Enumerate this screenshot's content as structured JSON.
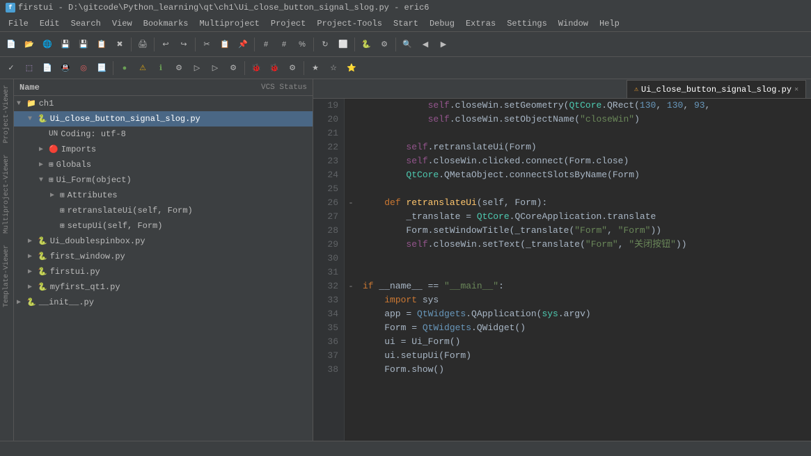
{
  "titleBar": {
    "icon": "f",
    "text": "firstui - D:\\gitcode\\Python_learning\\qt\\ch1\\Ui_close_button_signal_slog.py - eric6"
  },
  "menuBar": {
    "items": [
      "File",
      "Edit",
      "Search",
      "View",
      "Bookmarks",
      "Multiproject",
      "Project",
      "Project-Tools",
      "Start",
      "Debug",
      "Extras",
      "Settings",
      "Window",
      "Help"
    ]
  },
  "tabs": [
    {
      "label": "Ui_close_button_signal_slog.py",
      "active": true,
      "warning": true
    }
  ],
  "projectPanel": {
    "headerLeft": "Name",
    "headerRight": "VCS Status",
    "tree": [
      {
        "indent": 0,
        "arrow": "▼",
        "icon": "📁",
        "label": "ch1",
        "type": "folder"
      },
      {
        "indent": 1,
        "arrow": "▼",
        "icon": "🐍",
        "label": "Ui_close_button_signal_slog.py",
        "type": "file",
        "selected": true
      },
      {
        "indent": 2,
        "arrow": "",
        "icon": "UN",
        "label": "Coding: utf-8",
        "type": "info"
      },
      {
        "indent": 2,
        "arrow": "▶",
        "icon": "🔴",
        "label": "Imports",
        "type": "node"
      },
      {
        "indent": 2,
        "arrow": "▶",
        "icon": "⊞",
        "label": "Globals",
        "type": "node"
      },
      {
        "indent": 2,
        "arrow": "▼",
        "icon": "⊞",
        "label": "Ui_Form(object)",
        "type": "class"
      },
      {
        "indent": 3,
        "arrow": "▶",
        "icon": "⊞",
        "label": "Attributes",
        "type": "node"
      },
      {
        "indent": 3,
        "arrow": "",
        "icon": "⊞",
        "label": "retranslateUi(self, Form)",
        "type": "method"
      },
      {
        "indent": 3,
        "arrow": "",
        "icon": "⊞",
        "label": "setupUi(self, Form)",
        "type": "method"
      },
      {
        "indent": 1,
        "arrow": "▶",
        "icon": "🐍",
        "label": "Ui_doublespinbox.py",
        "type": "file"
      },
      {
        "indent": 1,
        "arrow": "▶",
        "icon": "🐍",
        "label": "first_window.py",
        "type": "file"
      },
      {
        "indent": 1,
        "arrow": "▶",
        "icon": "🐍",
        "label": "firstui.py",
        "type": "file"
      },
      {
        "indent": 1,
        "arrow": "▶",
        "icon": "🐍",
        "label": "myfirst_qt1.py",
        "type": "file"
      },
      {
        "indent": 0,
        "arrow": "▶",
        "icon": "🐍",
        "label": "__init__.py",
        "type": "file"
      }
    ]
  },
  "sideLabels": [
    "Project-Viewer",
    "Multiproject-Viewer",
    "Template-Viewer"
  ],
  "editor": {
    "filename": "Ui_close_button_signal_slog.py",
    "lines": [
      {
        "num": 19,
        "gutter": "",
        "code": [
          {
            "t": "            ",
            "c": "plain"
          },
          {
            "t": "self",
            "c": "self"
          },
          {
            "t": ".closeWin.setGeometry(",
            "c": "plain"
          },
          {
            "t": "QtCore",
            "c": "qt"
          },
          {
            "t": ".QRect(",
            "c": "plain"
          },
          {
            "t": "130",
            "c": "num"
          },
          {
            "t": ", ",
            "c": "plain"
          },
          {
            "t": "130",
            "c": "num"
          },
          {
            "t": ", ",
            "c": "plain"
          },
          {
            "t": "93",
            "c": "num"
          },
          {
            "t": ",",
            "c": "plain"
          }
        ]
      },
      {
        "num": 20,
        "gutter": "",
        "code": [
          {
            "t": "            ",
            "c": "plain"
          },
          {
            "t": "self",
            "c": "self"
          },
          {
            "t": ".closeWin.setObjectName(",
            "c": "plain"
          },
          {
            "t": "\"closeWin\"",
            "c": "str"
          },
          {
            "t": ")",
            "c": "plain"
          }
        ]
      },
      {
        "num": 21,
        "gutter": "",
        "code": [
          {
            "t": "",
            "c": "plain"
          }
        ]
      },
      {
        "num": 22,
        "gutter": "",
        "code": [
          {
            "t": "        ",
            "c": "plain"
          },
          {
            "t": "self",
            "c": "self"
          },
          {
            "t": ".retranslateUi(Form)",
            "c": "plain"
          }
        ]
      },
      {
        "num": 23,
        "gutter": "",
        "code": [
          {
            "t": "        ",
            "c": "plain"
          },
          {
            "t": "self",
            "c": "self"
          },
          {
            "t": ".closeWin.clicked.connect(Form.close)",
            "c": "plain"
          }
        ]
      },
      {
        "num": 24,
        "gutter": "",
        "code": [
          {
            "t": "        ",
            "c": "plain"
          },
          {
            "t": "QtCore",
            "c": "qt"
          },
          {
            "t": ".QMetaObject.connectSlotsByName(Form)",
            "c": "plain"
          }
        ]
      },
      {
        "num": 25,
        "gutter": "",
        "code": [
          {
            "t": "",
            "c": "plain"
          }
        ]
      },
      {
        "num": 26,
        "gutter": "-",
        "code": [
          {
            "t": "    ",
            "c": "plain"
          },
          {
            "t": "def ",
            "c": "kw2"
          },
          {
            "t": "retranslateUi",
            "c": "fn"
          },
          {
            "t": "(self, Form):",
            "c": "plain"
          }
        ]
      },
      {
        "num": 27,
        "gutter": "",
        "code": [
          {
            "t": "        ",
            "c": "plain"
          },
          {
            "t": "_translate",
            "c": "plain"
          },
          {
            "t": " = ",
            "c": "plain"
          },
          {
            "t": "QtCore",
            "c": "qt"
          },
          {
            "t": ".QCoreApplication.translate",
            "c": "plain"
          }
        ]
      },
      {
        "num": 28,
        "gutter": "",
        "code": [
          {
            "t": "        Form.setWindowTitle(_translate(",
            "c": "plain"
          },
          {
            "t": "\"Form\"",
            "c": "str"
          },
          {
            "t": ", ",
            "c": "plain"
          },
          {
            "t": "\"Form\"",
            "c": "str"
          },
          {
            "t": "))",
            "c": "plain"
          }
        ]
      },
      {
        "num": 29,
        "gutter": "",
        "code": [
          {
            "t": "        ",
            "c": "plain"
          },
          {
            "t": "self",
            "c": "self"
          },
          {
            "t": ".closeWin.setText(_translate(",
            "c": "plain"
          },
          {
            "t": "\"Form\"",
            "c": "str"
          },
          {
            "t": ", ",
            "c": "plain"
          },
          {
            "t": "\"关闭按钮\"",
            "c": "ch-str"
          },
          {
            "t": "))",
            "c": "plain"
          }
        ]
      },
      {
        "num": 30,
        "gutter": "",
        "code": [
          {
            "t": "",
            "c": "plain"
          }
        ]
      },
      {
        "num": 31,
        "gutter": "",
        "code": [
          {
            "t": "",
            "c": "plain"
          }
        ]
      },
      {
        "num": 32,
        "gutter": "-",
        "code": [
          {
            "t": "if ",
            "c": "kw"
          },
          {
            "t": "__name__",
            "c": "plain"
          },
          {
            "t": " == ",
            "c": "plain"
          },
          {
            "t": "\"__main__\"",
            "c": "str"
          },
          {
            "t": ":",
            "c": "plain"
          }
        ]
      },
      {
        "num": 33,
        "gutter": "",
        "code": [
          {
            "t": "    ",
            "c": "plain"
          },
          {
            "t": "import ",
            "c": "kw"
          },
          {
            "t": "sys",
            "c": "plain"
          }
        ]
      },
      {
        "num": 34,
        "gutter": "",
        "code": [
          {
            "t": "    app = ",
            "c": "plain"
          },
          {
            "t": "QtWidgets",
            "c": "qt2"
          },
          {
            "t": ".QApplication(",
            "c": "plain"
          },
          {
            "t": "sys",
            "c": "qt"
          },
          {
            "t": ".argv)",
            "c": "plain"
          }
        ]
      },
      {
        "num": 35,
        "gutter": "",
        "code": [
          {
            "t": "    Form = ",
            "c": "plain"
          },
          {
            "t": "QtWidgets",
            "c": "qt2"
          },
          {
            "t": ".QWidget()",
            "c": "plain"
          }
        ]
      },
      {
        "num": 36,
        "gutter": "",
        "code": [
          {
            "t": "    ui = Ui_Form()",
            "c": "plain"
          }
        ]
      },
      {
        "num": 37,
        "gutter": "",
        "code": [
          {
            "t": "    ui.setupUi(Form)",
            "c": "plain"
          }
        ]
      },
      {
        "num": 38,
        "gutter": "",
        "code": [
          {
            "t": "    Form.show()",
            "c": "plain"
          }
        ]
      }
    ]
  },
  "statusBar": {
    "text": ""
  },
  "colors": {
    "qtColor": "#4ec9b0",
    "qt2Color": "#6897bb",
    "kwColor": "#cc7832",
    "strColor": "#6a8759",
    "selfColor": "#94558d",
    "fnColor": "#ffc66d"
  }
}
